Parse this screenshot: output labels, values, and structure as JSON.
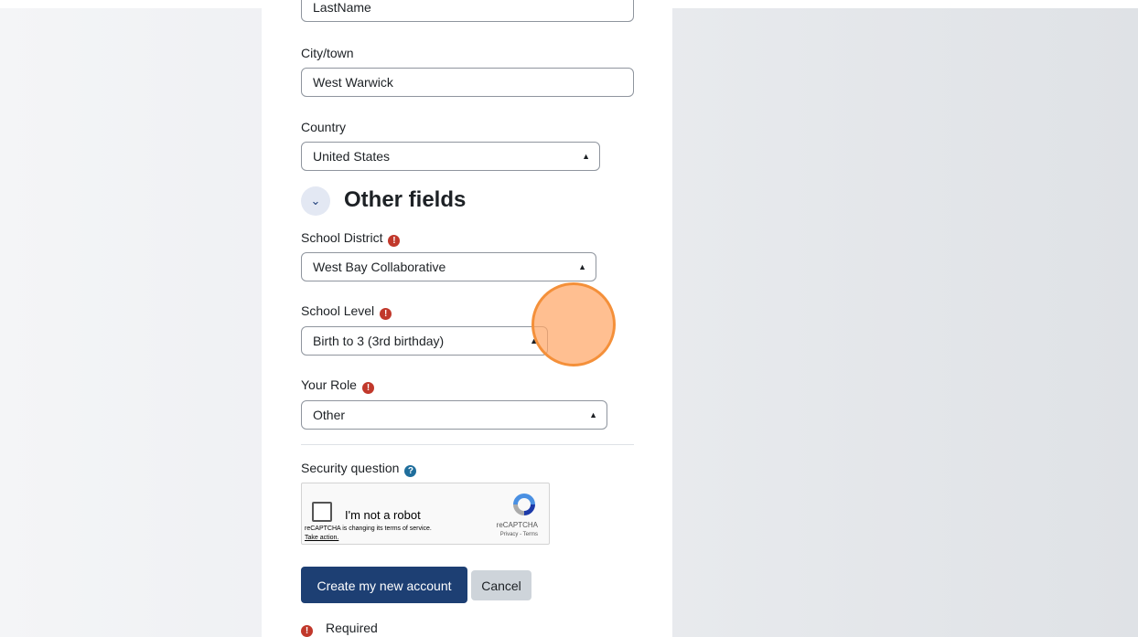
{
  "form": {
    "last_name_value": "LastName",
    "city_label": "City/town",
    "city_value": "West Warwick",
    "country_label": "Country",
    "country_value": "United States",
    "section_title": "Other fields",
    "district_label": "School District",
    "district_value": "West Bay Collaborative",
    "level_label": "School Level",
    "level_value": "Birth to 3 (3rd birthday)",
    "role_label": "Your Role",
    "role_value": "Other",
    "security_label": "Security question"
  },
  "captcha": {
    "checkbox_label": "I'm not a robot",
    "notice": "reCAPTCHA is changing its terms of service.",
    "action_link": "Take action.",
    "brand": "reCAPTCHA",
    "links": "Privacy - Terms"
  },
  "buttons": {
    "submit_label": "Create my new account",
    "cancel_label": "Cancel"
  },
  "footer": {
    "required_label": "Required"
  },
  "icons": {
    "required": "exclamation-circle-icon",
    "help": "question-circle-icon",
    "collapse": "chevron-down-icon",
    "select_caret": "sort-arrows-icon"
  },
  "colors": {
    "primary": "#1d3f73",
    "required": "#c1382b",
    "help": "#1f6e9c",
    "cursor_highlight": "#f4903a"
  }
}
